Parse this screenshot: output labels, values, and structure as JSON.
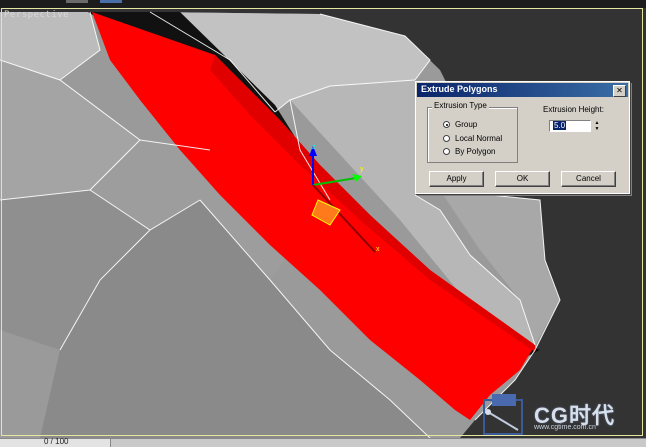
{
  "viewport": {
    "label": "Perspective"
  },
  "dialog": {
    "title": "Extrude Polygons",
    "close_glyph": "✕",
    "extrusion_type": {
      "label": "Extrusion Type",
      "options": [
        "Group",
        "Local Normal",
        "By Polygon"
      ],
      "selected": "Group"
    },
    "extrusion_height": {
      "label": "Extrusion Height:",
      "value": "5.0"
    },
    "buttons": {
      "apply": "Apply",
      "ok": "OK",
      "cancel": "Cancel"
    }
  },
  "gizmo": {
    "axis_x": "x",
    "axis_y": "y",
    "axis_z": "z"
  },
  "statusbar": {
    "frame_counter": "0 / 100"
  },
  "watermark": {
    "brand": "CG时代",
    "url": "www.cgtime.com.cn"
  },
  "colors": {
    "selection": "#ff0000",
    "mesh": "#9a9a9a",
    "wire": "#ffffff",
    "dialog_bg": "#d4d0c8",
    "title_bar": "#0a246a"
  }
}
